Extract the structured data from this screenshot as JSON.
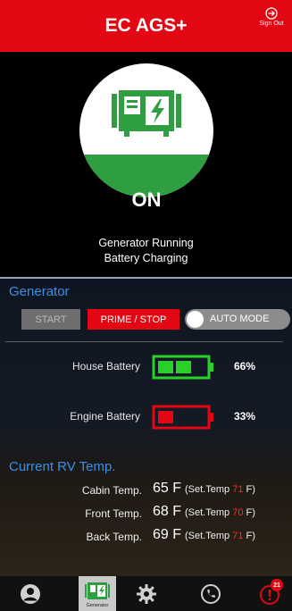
{
  "header": {
    "title": "EC AGS+",
    "signout_label": "Sign Out"
  },
  "status": {
    "state": "ON",
    "line1": "Generator Running",
    "line2": "Battery Charging",
    "colors": {
      "on_green": "#2e9e40",
      "icon_green": "#2e9e40"
    }
  },
  "generator": {
    "section_title": "Generator",
    "start_label": "START",
    "prime_stop_label": "PRIME / STOP",
    "auto_mode_label": "AUTO MODE",
    "auto_mode_on": false
  },
  "batteries": [
    {
      "label": "House Battery",
      "percent": "66%",
      "level": 0.66,
      "color": "#2ad02a"
    },
    {
      "label": "Engine Battery",
      "percent": "33%",
      "level": 0.33,
      "color": "#e30613"
    }
  ],
  "temps": {
    "section_title": "Current RV Temp.",
    "rows": [
      {
        "label": "Cabin Temp.",
        "value": "65 F",
        "set_prefix": "(Set.Temp",
        "set_value": "71",
        "set_suffix": "F)"
      },
      {
        "label": "Front Temp.",
        "value": "68 F",
        "set_prefix": "(Set.Temp",
        "set_value": "70",
        "set_suffix": "F)"
      },
      {
        "label": "Back Temp.",
        "value": "69 F",
        "set_prefix": "(Set.Temp",
        "set_value": "71",
        "set_suffix": "F)"
      }
    ]
  },
  "tabbar": {
    "tabs": [
      {
        "icon": "user-icon"
      },
      {
        "icon": "generator-icon",
        "label": "Generator",
        "active": true
      },
      {
        "icon": "gear-icon"
      },
      {
        "icon": "phone-icon"
      },
      {
        "icon": "alert-icon",
        "badge": "21"
      }
    ]
  }
}
